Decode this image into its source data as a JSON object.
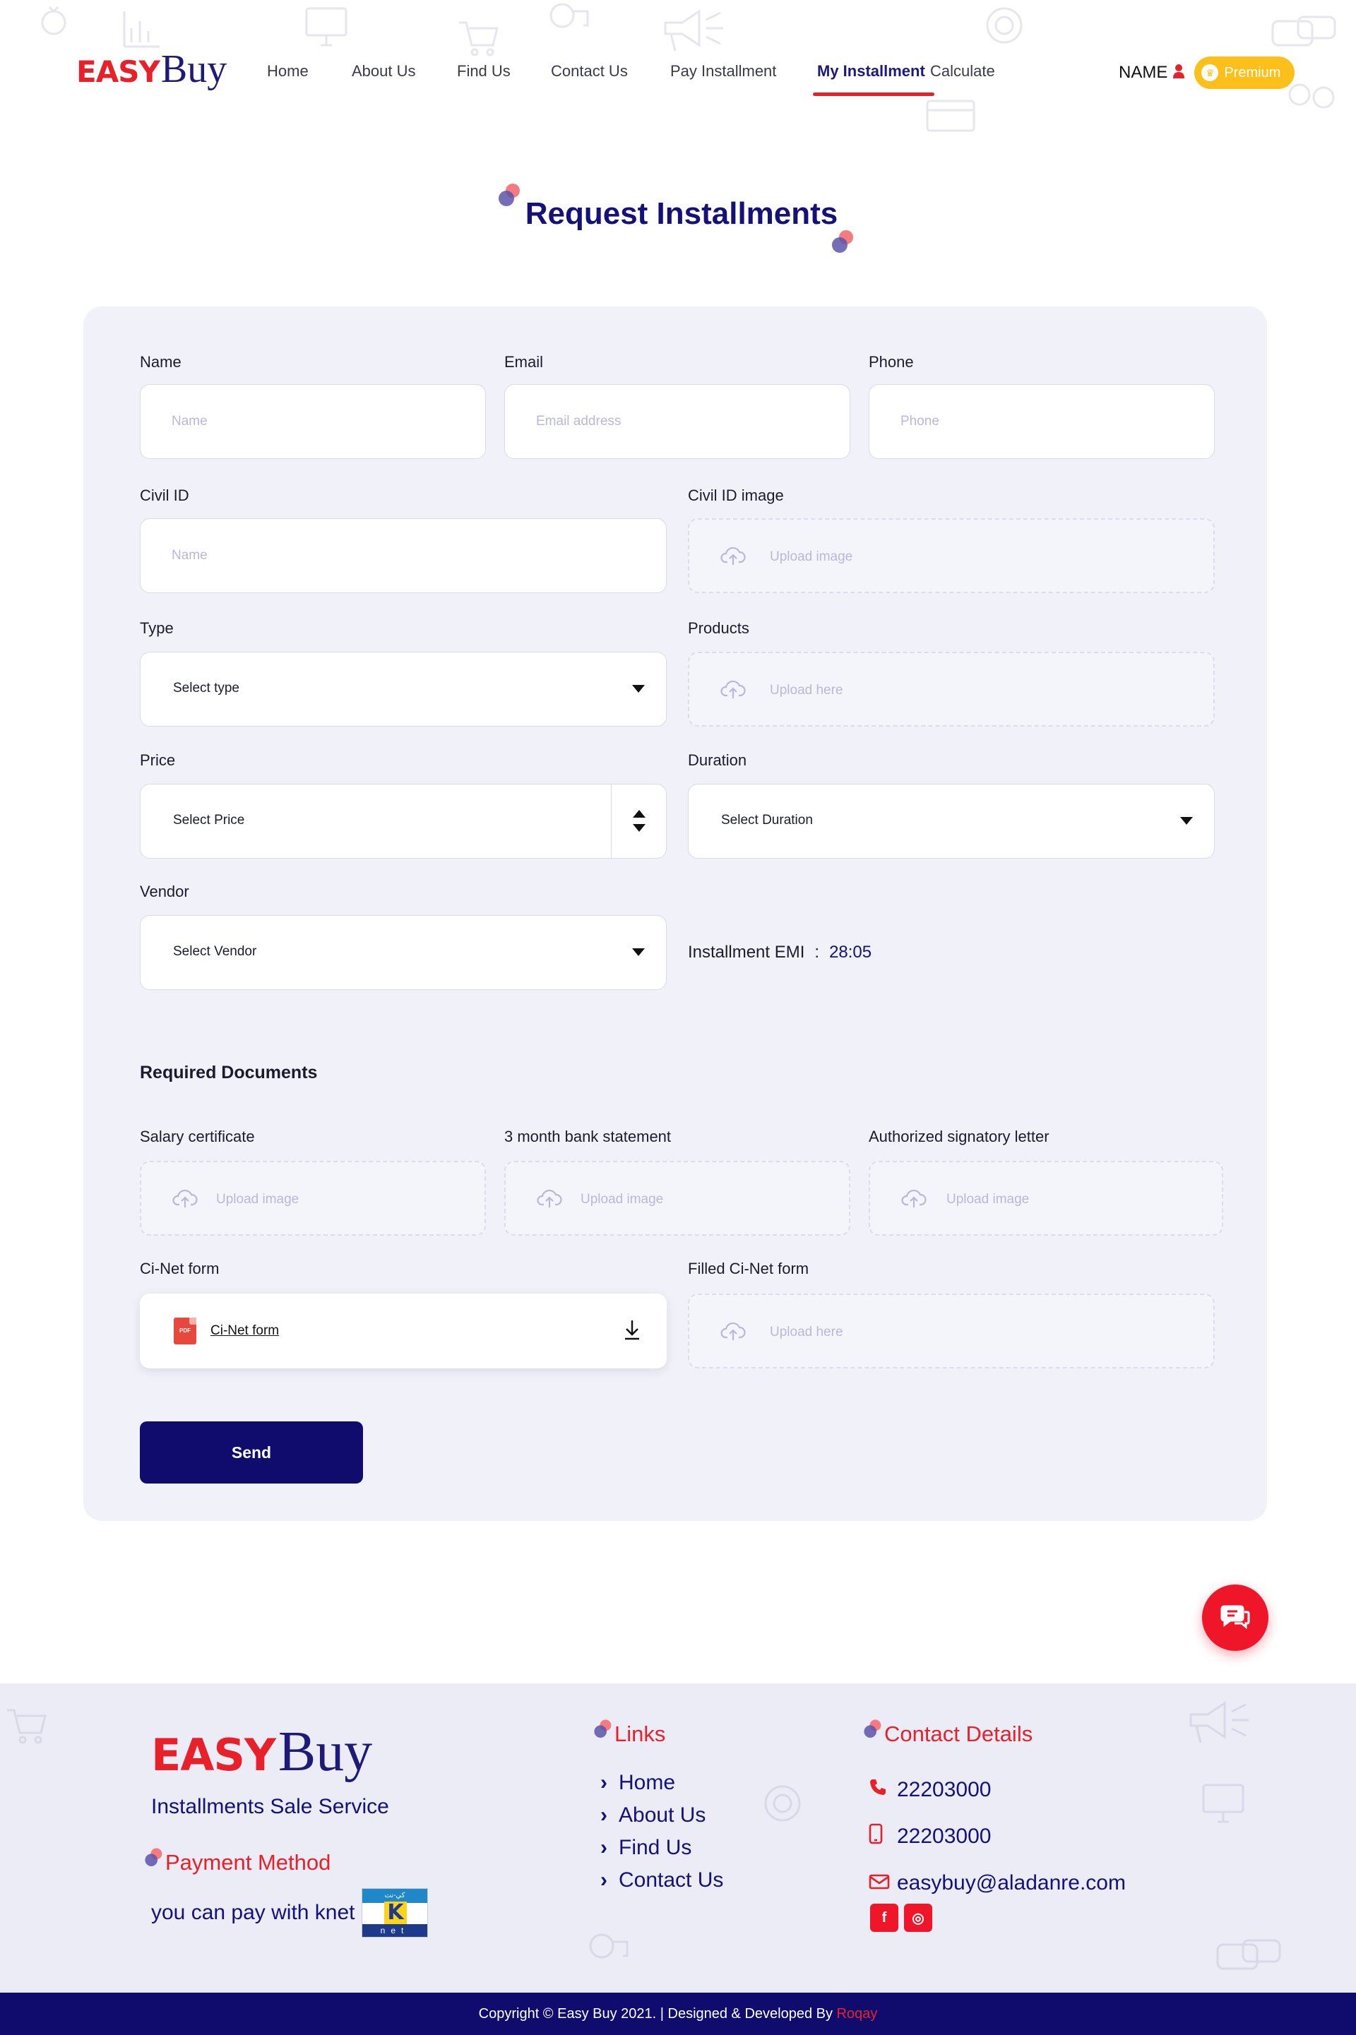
{
  "header": {
    "logo_easy": "EASY",
    "logo_buy": "Buy",
    "nav": [
      "Home",
      "About Us",
      "Find Us",
      "Contact Us",
      "Pay Installment",
      "My Installment",
      "Calculate"
    ],
    "active_nav": "My Installment",
    "user_name": "NAME",
    "premium_label": "Premium"
  },
  "page_title": "Request Installments",
  "form": {
    "name": {
      "label": "Name",
      "placeholder": "Name"
    },
    "email": {
      "label": "Email",
      "placeholder": "Email address"
    },
    "phone": {
      "label": "Phone",
      "placeholder": "Phone"
    },
    "civil_id": {
      "label": "Civil ID",
      "placeholder": "Name"
    },
    "civil_id_image": {
      "label": "Civil ID image",
      "placeholder": "Upload image"
    },
    "type": {
      "label": "Type",
      "value": "Select type"
    },
    "products": {
      "label": "Products",
      "placeholder": "Upload here"
    },
    "price": {
      "label": "Price",
      "value": "Select Price"
    },
    "duration": {
      "label": "Duration",
      "value": "Select Duration"
    },
    "vendor": {
      "label": "Vendor",
      "value": "Select Vendor"
    },
    "emi_label": "Installment EMI",
    "emi_colon": ":",
    "emi_value": "28:05"
  },
  "documents": {
    "title": "Required Documents",
    "salary": {
      "label": "Salary certificate",
      "placeholder": "Upload image"
    },
    "bank": {
      "label": "3 month bank statement",
      "placeholder": "Upload image"
    },
    "auth": {
      "label": "Authorized signatory letter",
      "placeholder": "Upload image"
    },
    "cinet": {
      "label": "Ci-Net form",
      "file": "Ci-Net form",
      "pdf_badge": "PDF"
    },
    "filled_cinet": {
      "label": "Filled Ci-Net form",
      "placeholder": "Upload here"
    }
  },
  "send_label": "Send",
  "footer": {
    "logo_easy": "EASY",
    "logo_buy": "Buy",
    "tagline": "Installments Sale Service",
    "payment_title": "Payment Method",
    "payment_text": "you can pay with knet",
    "knet_top": "كي-نت",
    "knet_k": "K",
    "knet_bottom": "net",
    "links_title": "Links",
    "links": [
      "Home",
      "About Us",
      "Find Us",
      "Contact Us"
    ],
    "contact_title": "Contact Details",
    "phone": "22203000",
    "mobile": "22203000",
    "email": "easybuy@aladanre.com",
    "facebook": "f",
    "instagram": "◎"
  },
  "copyright": {
    "text": "Copyright © Easy Buy 2021. | Designed & Developed By ",
    "developer": "Roqay"
  },
  "colors": {
    "brand_red": "#e8202a",
    "brand_navy": "#0f0c6e",
    "premium_yellow": "#fdbf1a",
    "card_bg": "#f1f1f9"
  },
  "icons": [
    "user-icon",
    "crown-icon",
    "cloud-upload-icon",
    "caret-down-icon",
    "spinner-icon",
    "pdf-icon",
    "download-icon",
    "chat-icon",
    "chevron-right-icon",
    "phone-icon",
    "mobile-icon",
    "mail-icon"
  ]
}
